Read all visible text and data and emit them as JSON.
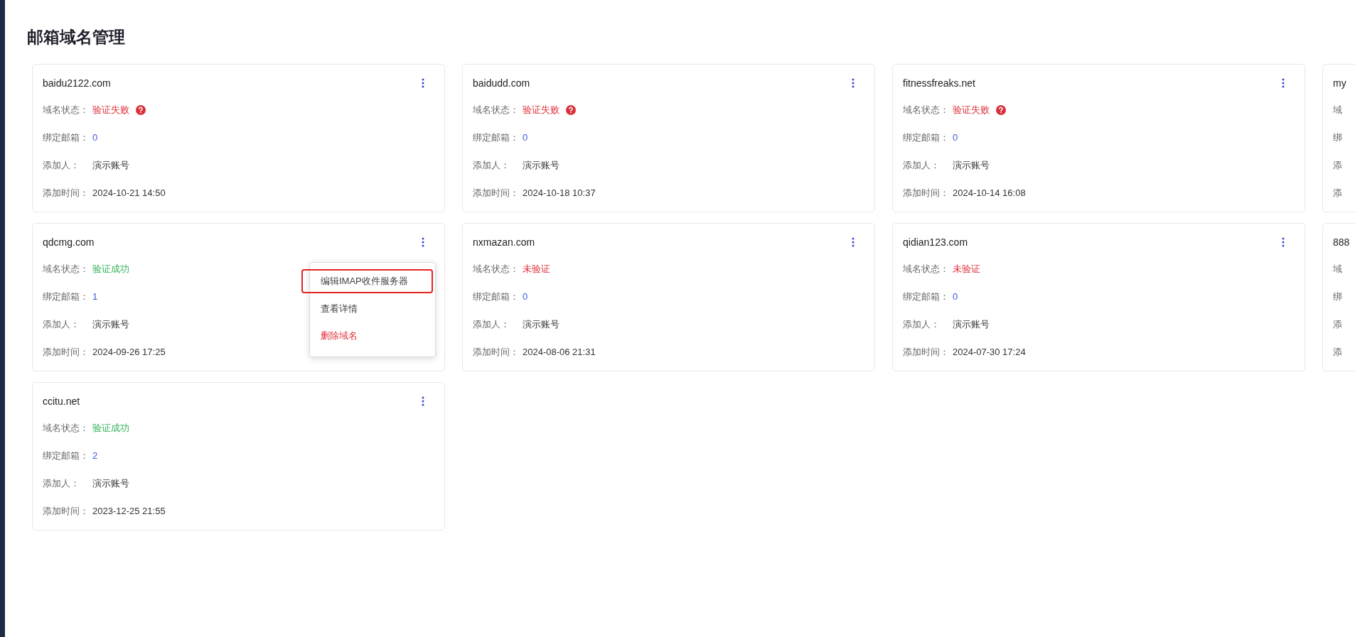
{
  "page": {
    "title": "邮箱域名管理"
  },
  "cards": [
    {
      "domain": "baidu2122.com",
      "fields": [
        {
          "kind": "status",
          "label": "域名状态：",
          "value": "验证失败",
          "verified": false,
          "help": true
        },
        {
          "kind": "count",
          "label": "绑定邮箱：",
          "value": "0"
        },
        {
          "kind": "text",
          "label": "添加人：",
          "value": "演示账号"
        },
        {
          "kind": "text",
          "label": "添加时间：",
          "value": "2024-10-21 14:50"
        }
      ]
    },
    {
      "domain": "baidudd.com",
      "fields": [
        {
          "kind": "status",
          "label": "域名状态：",
          "value": "验证失败",
          "verified": false,
          "help": true
        },
        {
          "kind": "count",
          "label": "绑定邮箱：",
          "value": "0"
        },
        {
          "kind": "text",
          "label": "添加人：",
          "value": "演示账号"
        },
        {
          "kind": "text",
          "label": "添加时间：",
          "value": "2024-10-18 10:37"
        }
      ]
    },
    {
      "domain": "fitnessfreaks.net",
      "fields": [
        {
          "kind": "status",
          "label": "域名状态：",
          "value": "验证失败",
          "verified": false,
          "help": true
        },
        {
          "kind": "count",
          "label": "绑定邮箱：",
          "value": "0"
        },
        {
          "kind": "text",
          "label": "添加人：",
          "value": "演示账号"
        },
        {
          "kind": "text",
          "label": "添加时间：",
          "value": "2024-10-14 16:08"
        }
      ]
    },
    {
      "domain": "my",
      "fields": [
        {
          "label": "域"
        },
        {
          "label": "绑"
        },
        {
          "label": "添"
        },
        {
          "label": "添"
        }
      ]
    },
    {
      "domain": "qdcmg.com",
      "fields": [
        {
          "kind": "status",
          "label": "域名状态：",
          "value": "验证成功",
          "verified": true,
          "help": false
        },
        {
          "kind": "count",
          "label": "绑定邮箱：",
          "value": "1"
        },
        {
          "kind": "text",
          "label": "添加人：",
          "value": "演示账号"
        },
        {
          "kind": "text",
          "label": "添加时间：",
          "value": "2024-09-26 17:25"
        }
      ],
      "menu": {
        "items": [
          {
            "label": "编辑IMAP收件服务器",
            "kind": "normal",
            "highlighted": true
          },
          {
            "label": "查看详情",
            "kind": "normal",
            "highlighted": false
          },
          {
            "label": "删除域名",
            "kind": "danger",
            "highlighted": false
          }
        ]
      }
    },
    {
      "domain": "nxmazan.com",
      "fields": [
        {
          "kind": "status",
          "label": "域名状态：",
          "value": "未验证",
          "verified": false,
          "help": false
        },
        {
          "kind": "count",
          "label": "绑定邮箱：",
          "value": "0"
        },
        {
          "kind": "text",
          "label": "添加人：",
          "value": "演示账号"
        },
        {
          "kind": "text",
          "label": "添加时间：",
          "value": "2024-08-06 21:31"
        }
      ]
    },
    {
      "domain": "qidian123.com",
      "fields": [
        {
          "kind": "status",
          "label": "域名状态：",
          "value": "未验证",
          "verified": false,
          "help": false
        },
        {
          "kind": "count",
          "label": "绑定邮箱：",
          "value": "0"
        },
        {
          "kind": "text",
          "label": "添加人：",
          "value": "演示账号"
        },
        {
          "kind": "text",
          "label": "添加时间：",
          "value": "2024-07-30 17:24"
        }
      ]
    },
    {
      "domain": "888",
      "fields": [
        {
          "label": "域"
        },
        {
          "label": "绑"
        },
        {
          "label": "添"
        },
        {
          "label": "添"
        }
      ]
    },
    {
      "domain": "ccitu.net",
      "fields": [
        {
          "kind": "status",
          "label": "域名状态：",
          "value": "验证成功",
          "verified": true,
          "help": false
        },
        {
          "kind": "count",
          "label": "绑定邮箱：",
          "value": "2"
        },
        {
          "kind": "text",
          "label": "添加人：",
          "value": "演示账号"
        },
        {
          "kind": "text",
          "label": "添加时间：",
          "value": "2023-12-25 21:55"
        }
      ]
    }
  ]
}
